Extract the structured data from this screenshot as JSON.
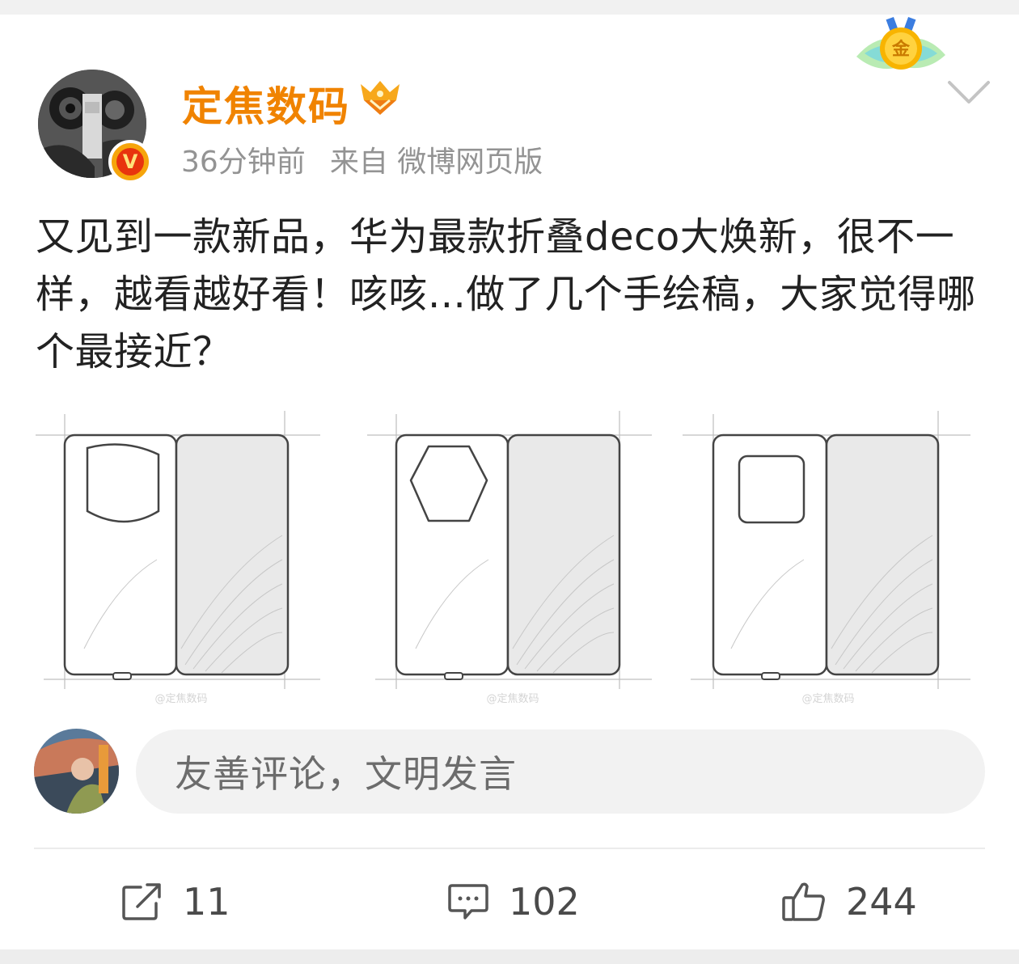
{
  "post": {
    "author": "定焦数码",
    "time": "36分钟前",
    "source": "来自 微博网页版",
    "verified_badge": "V",
    "medal_label": "金",
    "text": "又见到一款新品，华为最款折叠deco大焕新，很不一样，越看越好看！咳咳...做了几个手绘稿，大家觉得哪个最接近？",
    "images": [
      {
        "camera_shape": "circle",
        "watermark": "@定焦数码"
      },
      {
        "camera_shape": "hexagon",
        "watermark": "@定焦数码"
      },
      {
        "camera_shape": "square",
        "watermark": "@定焦数码"
      }
    ]
  },
  "comment_box": {
    "placeholder": "友善评论，文明发言"
  },
  "actions": {
    "repost_count": "11",
    "comment_count": "102",
    "like_count": "244"
  },
  "icons": {
    "more": "chevron-down-icon",
    "member": "vip-crown-icon",
    "repost": "repost-icon",
    "comment": "comment-icon",
    "like": "thumbs-up-icon"
  },
  "colors": {
    "username": "#f08300",
    "meta": "#939393",
    "text": "#222222",
    "background": "#ffffff"
  }
}
